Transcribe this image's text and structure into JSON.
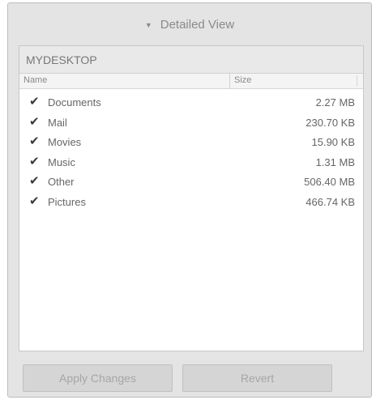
{
  "header": {
    "toggle_label": "Detailed View",
    "toggle_icon": "caret-down-icon"
  },
  "device": {
    "name": "MYDESKTOP"
  },
  "table": {
    "columns": [
      "Name",
      "Size"
    ],
    "rows": [
      {
        "name": "Documents",
        "size": "2.27 MB",
        "checked": true
      },
      {
        "name": "Mail",
        "size": "230.70 KB",
        "checked": true
      },
      {
        "name": "Movies",
        "size": "15.90 KB",
        "checked": true
      },
      {
        "name": "Music",
        "size": "1.31 MB",
        "checked": true
      },
      {
        "name": "Other",
        "size": "506.40 MB",
        "checked": true
      },
      {
        "name": "Pictures",
        "size": "466.74 KB",
        "checked": true
      }
    ]
  },
  "buttons": {
    "apply_label": "Apply Changes",
    "revert_label": "Revert"
  }
}
